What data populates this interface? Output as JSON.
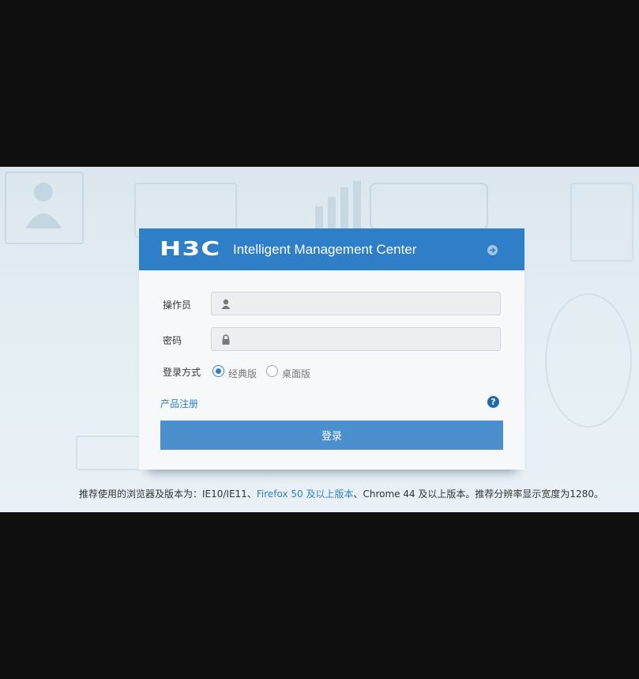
{
  "header": {
    "logo_text": "H3C",
    "app_title": "Intelligent Management Center"
  },
  "form": {
    "operator_label": "操作员",
    "operator_value": "",
    "password_label": "密码",
    "password_value": "",
    "login_mode_label": "登录方式",
    "login_modes": [
      {
        "label": "经典版",
        "selected": true
      },
      {
        "label": "桌面版",
        "selected": false
      }
    ],
    "register_link": "产品注册",
    "help_symbol": "?",
    "login_button": "登录"
  },
  "footnote": {
    "part1": "推荐使用的浏览器及版本为：IE10/IE11、",
    "part2": "Firefox 50 及以上版本",
    "part3": "、Chrome 44 及以上版本。推荐分辨率显示宽度为1280。"
  },
  "colors": {
    "header_blue": "#2e7fc8",
    "button_blue": "#4b8fcc",
    "link_blue": "#2e7fc8",
    "page_black": "#0f0f10"
  },
  "icons": {
    "header": "arrow-right-circle-icon",
    "operator": "user-icon",
    "password": "lock-icon",
    "help": "help-circle-icon"
  }
}
